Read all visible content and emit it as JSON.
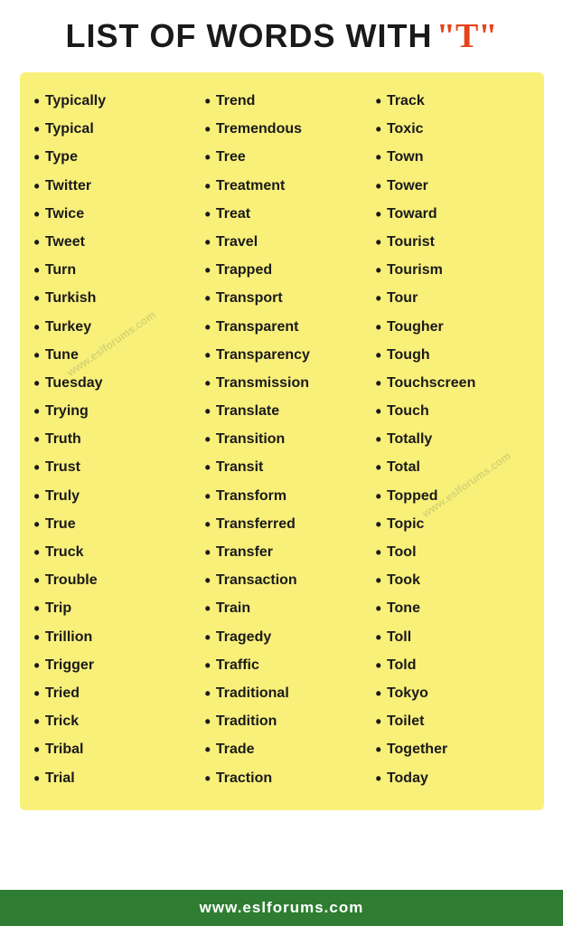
{
  "header": {
    "title": "LIST OF WORDS WITH",
    "highlight": "\"T\""
  },
  "columns": [
    {
      "id": "col1",
      "words": [
        "Typically",
        "Typical",
        "Type",
        "Twitter",
        "Twice",
        "Tweet",
        "Turn",
        "Turkish",
        "Turkey",
        "Tune",
        "Tuesday",
        "Trying",
        "Truth",
        "Trust",
        "Truly",
        "True",
        "Truck",
        "Trouble",
        "Trip",
        "Trillion",
        "Trigger",
        "Tried",
        "Trick",
        "Tribal",
        "Trial"
      ]
    },
    {
      "id": "col2",
      "words": [
        "Trend",
        "Tremendous",
        "Tree",
        "Treatment",
        "Treat",
        "Travel",
        "Trapped",
        "Transport",
        "Transparent",
        "Transparency",
        "Transmission",
        "Translate",
        "Transition",
        "Transit",
        "Transform",
        "Transferred",
        "Transfer",
        "Transaction",
        "Train",
        "Tragedy",
        "Traffic",
        "Traditional",
        "Tradition",
        "Trade",
        "Traction"
      ]
    },
    {
      "id": "col3",
      "words": [
        "Track",
        "Toxic",
        "Town",
        "Tower",
        "Toward",
        "Tourist",
        "Tourism",
        "Tour",
        "Tougher",
        "Tough",
        "Touchscreen",
        "Touch",
        "Totally",
        "Total",
        "Topped",
        "Topic",
        "Tool",
        "Took",
        "Tone",
        "Toll",
        "Told",
        "Tokyo",
        "Toilet",
        "Together",
        "Today"
      ]
    }
  ],
  "watermarks": [
    "www.eslforums.com",
    "www.eslforums.com",
    "www.eslforums.com"
  ],
  "footer": {
    "url": "www.eslforums.com"
  }
}
